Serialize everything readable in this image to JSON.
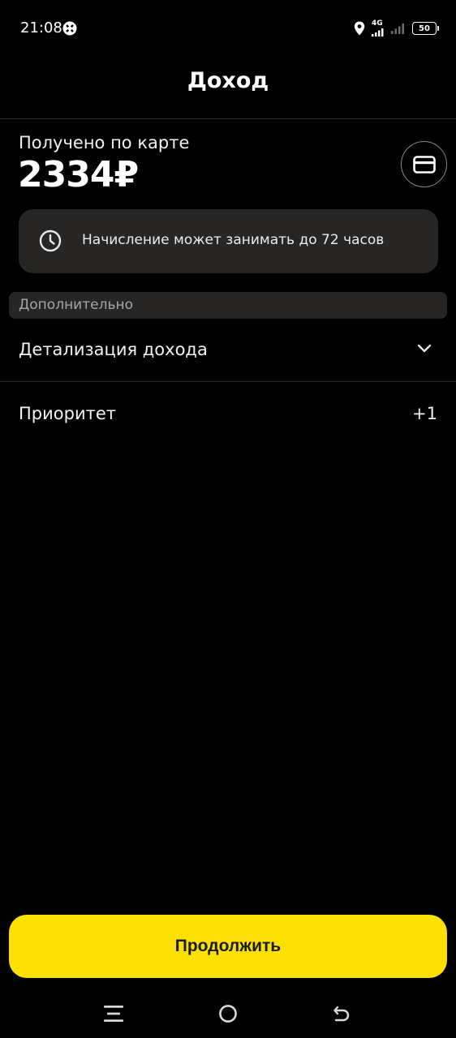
{
  "status_bar": {
    "time": "21:08",
    "network": "4G",
    "battery": "50"
  },
  "header": {
    "title": "Доход"
  },
  "income": {
    "label": "Получено по карте",
    "amount": "2334₽"
  },
  "notice": {
    "icon": "clock-icon",
    "text": "Начисление может занимать до 72 часов"
  },
  "additional": {
    "header": "Дополнительно",
    "details_label": "Детализация дохода",
    "priority_label": "Приоритет",
    "priority_value": "+1"
  },
  "actions": {
    "continue_label": "Продолжить"
  },
  "colors": {
    "background": "#000000",
    "surface": "#272625",
    "accent": "#fce000"
  }
}
